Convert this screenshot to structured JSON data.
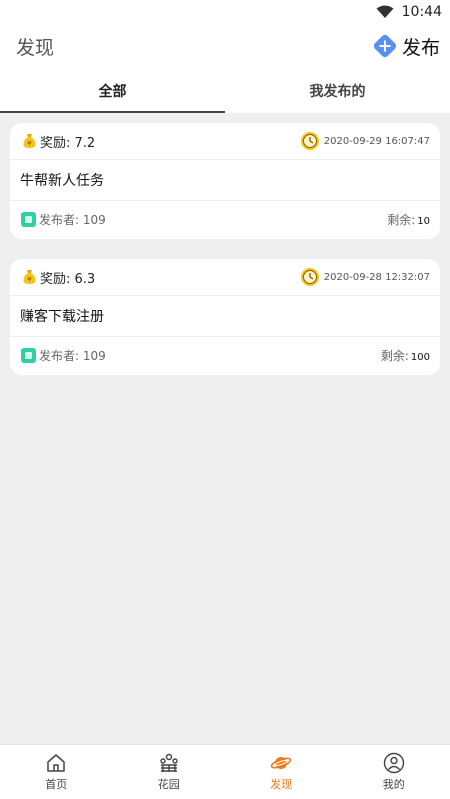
{
  "status": {
    "time": "10:44"
  },
  "header": {
    "title": "发现",
    "publish_label": "发布"
  },
  "tabs": [
    {
      "label": "全部",
      "active": true
    },
    {
      "label": "我发布的",
      "active": false
    }
  ],
  "tasks": [
    {
      "reward": "奖励: 7.2",
      "time": "2020-09-29 16:07:47",
      "title": "牛帮新人任务",
      "publisher": "发布者: 109",
      "remain_label": "剩余:",
      "remain_value": "10"
    },
    {
      "reward": "奖励: 6.3",
      "time": "2020-09-28 12:32:07",
      "title": "赚客下载注册",
      "publisher": "发布者: 109",
      "remain_label": "剩余:",
      "remain_value": "100"
    }
  ],
  "nav": [
    {
      "label": "首页",
      "icon": "home-icon"
    },
    {
      "label": "花园",
      "icon": "garden-icon"
    },
    {
      "label": "发现",
      "icon": "planet-icon",
      "active": true
    },
    {
      "label": "我的",
      "icon": "user-icon"
    }
  ],
  "colors": {
    "accent": "#f07a1a",
    "publish": "#5b8ff5",
    "publisher_badge": "#2ed1a3",
    "reward": "#f5c518"
  }
}
